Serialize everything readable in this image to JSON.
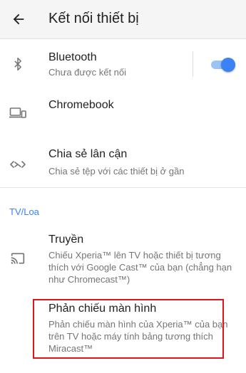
{
  "appbar": {
    "title": "Kết nối thiết bị",
    "back_icon": "arrow-left-icon"
  },
  "items": [
    {
      "title": "Bluetooth",
      "subtitle": "Chưa được kết nối",
      "icon": "bluetooth-icon",
      "toggle_on": true
    },
    {
      "title": "Chromebook",
      "icon": "laptop-phone-icon"
    },
    {
      "title": "Chia sẻ lân cận",
      "subtitle": "Chia sẻ tệp với các thiết bị ở gần",
      "icon": "nearby-share-icon"
    }
  ],
  "section": {
    "header": "TV/Loa"
  },
  "cast_items": [
    {
      "title": "Truyền",
      "subtitle": "Chiếu Xperia™ lên TV hoặc thiết bị tương thích với Google Cast™ của bạn (chẳng hạn như Chromecast™)",
      "icon": "cast-icon"
    },
    {
      "title": "Phản chiếu màn hình",
      "subtitle": "Phản chiếu màn hình của Xperia™ của bạn trên TV hoặc máy tính bảng tương thích Miracast™"
    }
  ],
  "colors": {
    "accent": "#3b82f6",
    "toggle_track": "#9cc3f5",
    "highlight_border": "#e0141c",
    "icon": "#757575"
  }
}
